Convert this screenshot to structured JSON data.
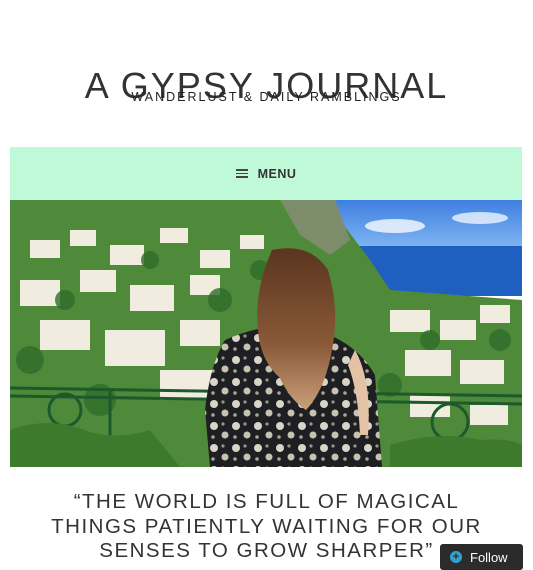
{
  "header": {
    "site_title": "A GYPSY JOURNAL",
    "tagline": "WANDERLUST & DAILY RAMBLINGS"
  },
  "nav": {
    "menu_label": "MENU",
    "menu_icon": "hamburger-icon",
    "background_color": "#bff9d8"
  },
  "hero": {
    "image_subject": "woman looking over hillside town and sea"
  },
  "quote": {
    "text": "“THE WORLD IS FULL OF MAGICAL\nTHINGS PATIENTLY WAITING FOR OUR\nSENSES TO GROW SHARPER”"
  },
  "follow": {
    "label": "Follow",
    "icon": "plus-circle-icon",
    "accent_color": "#2ea2cc"
  }
}
